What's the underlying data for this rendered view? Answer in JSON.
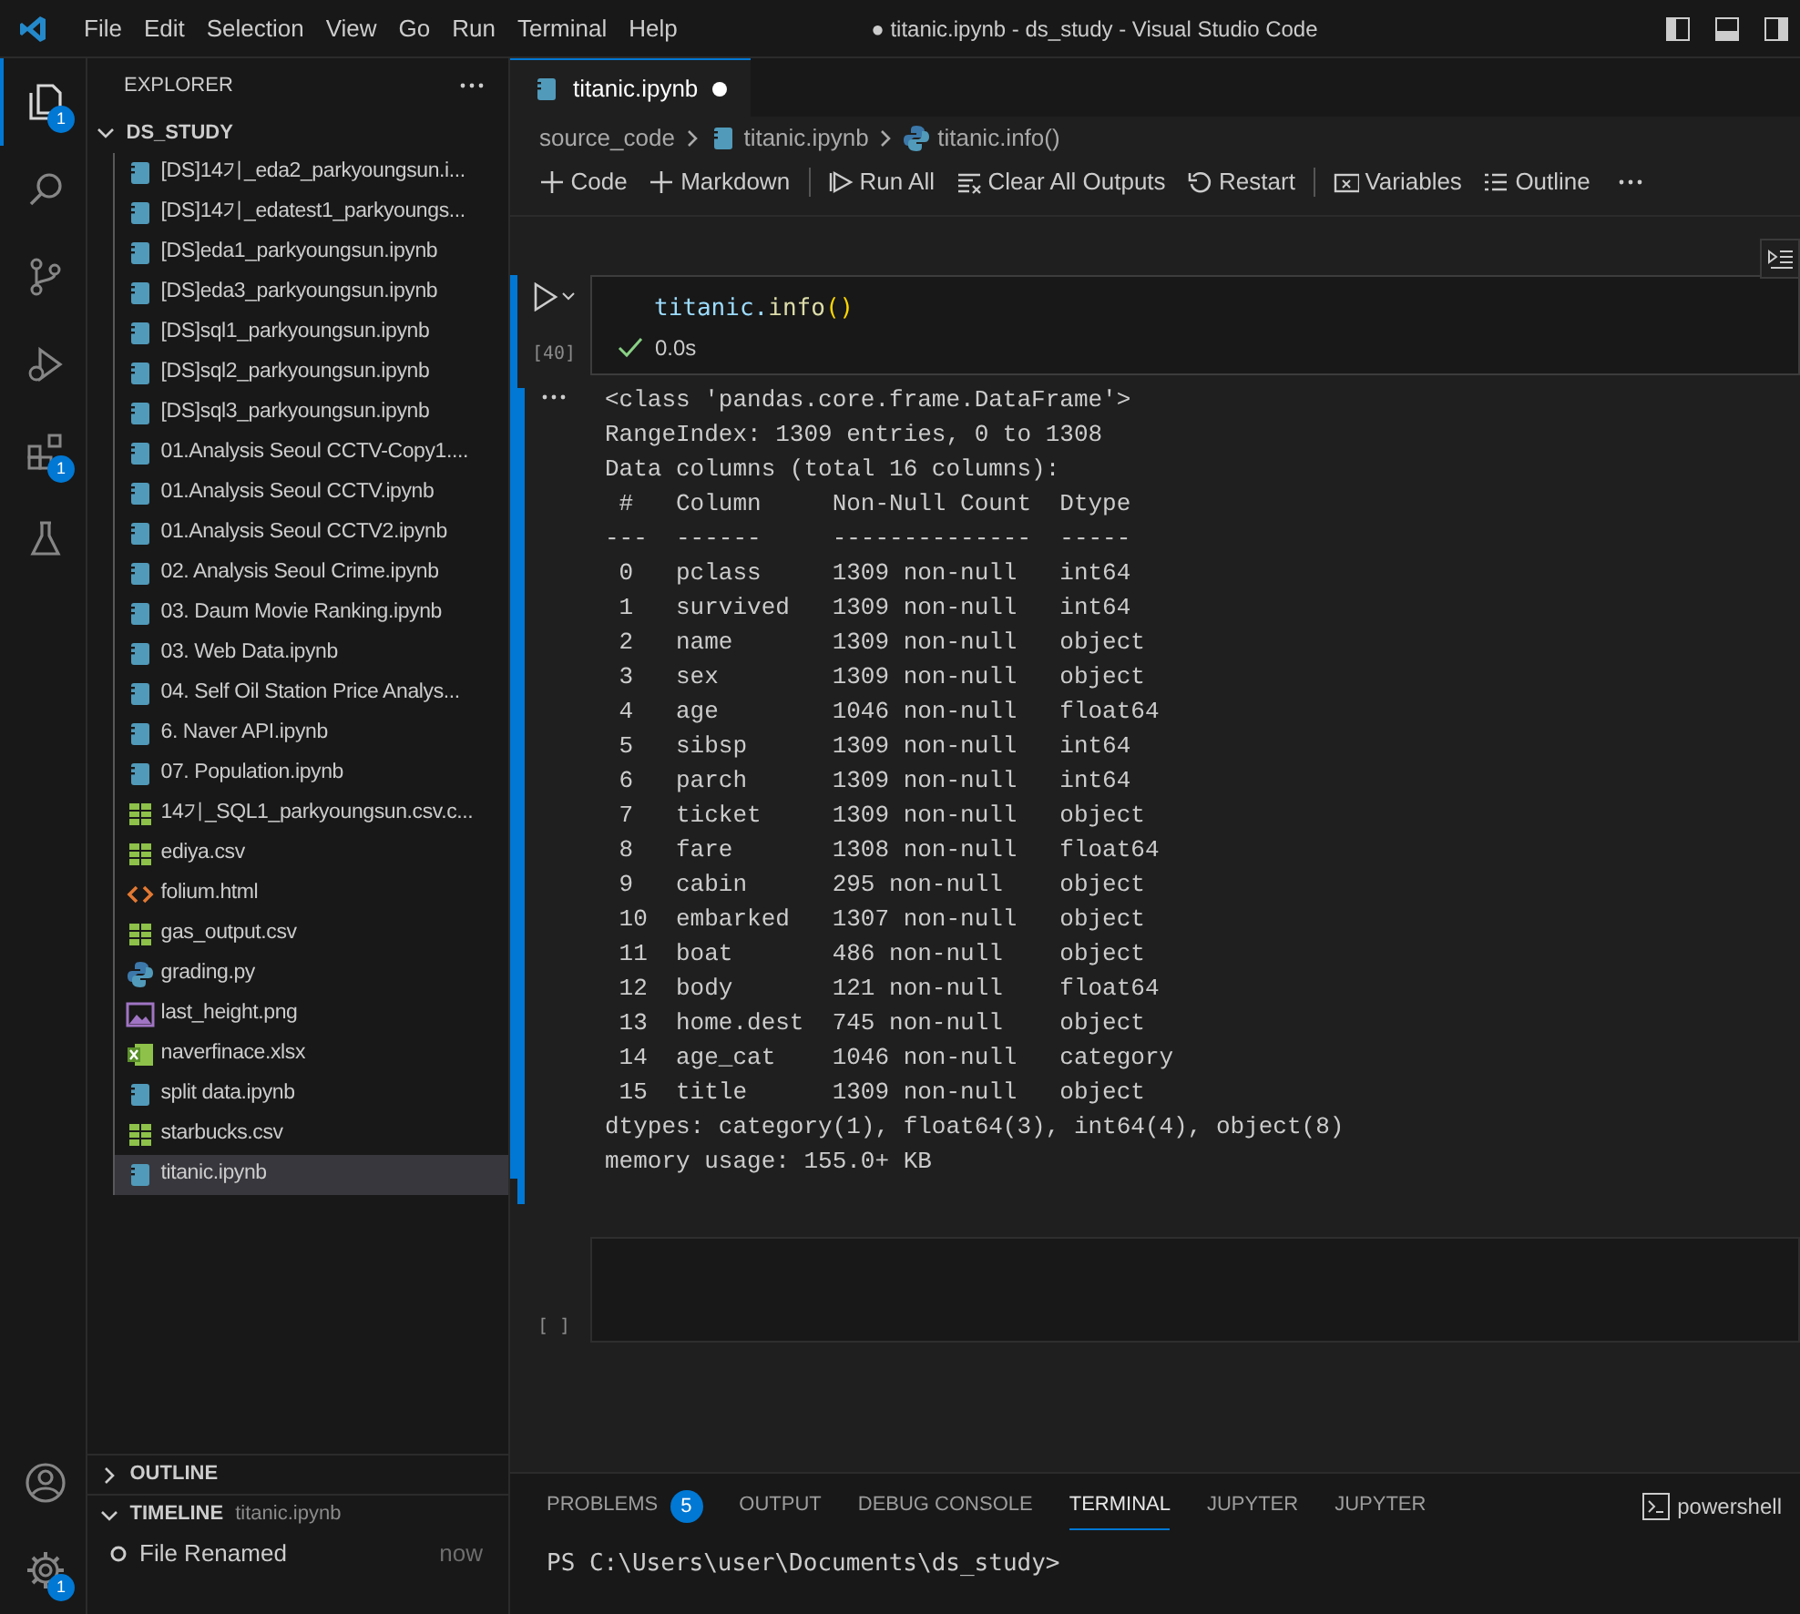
{
  "title_bar": {
    "menu": [
      "File",
      "Edit",
      "Selection",
      "View",
      "Go",
      "Run",
      "Terminal",
      "Help"
    ],
    "title": "● titanic.ipynb - ds_study - Visual Studio Code"
  },
  "activity_bar": [
    {
      "kind": "explorer",
      "selected": true,
      "badge": "1"
    },
    {
      "kind": "search",
      "selected": false
    },
    {
      "kind": "source-control",
      "selected": false
    },
    {
      "kind": "debug",
      "selected": false
    },
    {
      "kind": "extensions",
      "selected": false,
      "badge": "1"
    },
    {
      "kind": "testing",
      "selected": false
    }
  ],
  "activity_bottom": [
    {
      "kind": "account"
    },
    {
      "kind": "settings",
      "badge": "1"
    }
  ],
  "sidebar": {
    "title": "EXPLORER",
    "folder": "DS_STUDY",
    "files": [
      {
        "name": "[DS]14기_eda2_parkyoungsun.i...",
        "kind": "notebook",
        "selected": false
      },
      {
        "name": "[DS]14기_edatest1_parkyoungs...",
        "kind": "notebook",
        "selected": false
      },
      {
        "name": "[DS]eda1_parkyoungsun.ipynb",
        "kind": "notebook",
        "selected": false
      },
      {
        "name": "[DS]eda3_parkyoungsun.ipynb",
        "kind": "notebook",
        "selected": false
      },
      {
        "name": "[DS]sql1_parkyoungsun.ipynb",
        "kind": "notebook",
        "selected": false
      },
      {
        "name": "[DS]sql2_parkyoungsun.ipynb",
        "kind": "notebook",
        "selected": false
      },
      {
        "name": "[DS]sql3_parkyoungsun.ipynb",
        "kind": "notebook",
        "selected": false
      },
      {
        "name": "01.Analysis Seoul CCTV-Copy1....",
        "kind": "notebook",
        "selected": false
      },
      {
        "name": "01.Analysis Seoul CCTV.ipynb",
        "kind": "notebook",
        "selected": false
      },
      {
        "name": "01.Analysis Seoul CCTV2.ipynb",
        "kind": "notebook",
        "selected": false
      },
      {
        "name": "02. Analysis Seoul Crime.ipynb",
        "kind": "notebook",
        "selected": false
      },
      {
        "name": "03. Daum Movie Ranking.ipynb",
        "kind": "notebook",
        "selected": false
      },
      {
        "name": "03. Web Data.ipynb",
        "kind": "notebook",
        "selected": false
      },
      {
        "name": "04. Self Oil Station Price Analys...",
        "kind": "notebook",
        "selected": false
      },
      {
        "name": "6. Naver API.ipynb",
        "kind": "notebook",
        "selected": false
      },
      {
        "name": "07. Population.ipynb",
        "kind": "notebook",
        "selected": false
      },
      {
        "name": "14기_SQL1_parkyoungsun.csv.c...",
        "kind": "csv",
        "selected": false
      },
      {
        "name": "ediya.csv",
        "kind": "csv",
        "selected": false
      },
      {
        "name": "folium.html",
        "kind": "html",
        "selected": false
      },
      {
        "name": "gas_output.csv",
        "kind": "csv",
        "selected": false
      },
      {
        "name": "grading.py",
        "kind": "python",
        "selected": false
      },
      {
        "name": "last_height.png",
        "kind": "image",
        "selected": false
      },
      {
        "name": "naverfinace.xlsx",
        "kind": "excel",
        "selected": false
      },
      {
        "name": "split data.ipynb",
        "kind": "notebook",
        "selected": false
      },
      {
        "name": "starbucks.csv",
        "kind": "csv",
        "selected": false
      },
      {
        "name": "titanic.ipynb",
        "kind": "notebook",
        "selected": true
      }
    ],
    "outline": {
      "label": "OUTLINE",
      "expanded": false
    },
    "timeline": {
      "label": "TIMELINE",
      "subtitle": "titanic.ipynb",
      "expanded": true,
      "entries": [
        {
          "label": "File Renamed",
          "time": "now"
        }
      ]
    }
  },
  "editor": {
    "tabs": [
      {
        "label": "titanic.ipynb",
        "dirty": true,
        "selected": true
      }
    ],
    "breadcrumbs": [
      "source_code",
      "titanic.ipynb",
      "titanic.info()"
    ],
    "toolbar": [
      {
        "label": "Code",
        "kind": "plus"
      },
      {
        "label": "Markdown",
        "kind": "plus"
      },
      {
        "label": "Run All",
        "kind": "run"
      },
      {
        "label": "Clear All Outputs",
        "kind": "clear"
      },
      {
        "label": "Restart",
        "kind": "restart"
      },
      {
        "label": "Variables",
        "kind": "variables"
      },
      {
        "label": "Outline",
        "kind": "outline"
      }
    ],
    "cells": [
      {
        "execution": "[40]",
        "code": [
          {
            "text": "titanic.",
            "kind": "variable"
          },
          {
            "text": "info",
            "kind": "function"
          },
          {
            "text": "()",
            "kind": "bracket"
          }
        ],
        "status": "0.0s",
        "focused": true,
        "output": [
          "<class 'pandas.core.frame.DataFrame'>",
          "RangeIndex: 1309 entries, 0 to 1308",
          "Data columns (total 16 columns):",
          " #   Column     Non-Null Count  Dtype   ",
          "---  ------     --------------  -----   ",
          " 0   pclass     1309 non-null   int64   ",
          " 1   survived   1309 non-null   int64   ",
          " 2   name       1309 non-null   object  ",
          " 3   sex        1309 non-null   object  ",
          " 4   age        1046 non-null   float64 ",
          " 5   sibsp      1309 non-null   int64   ",
          " 6   parch      1309 non-null   int64   ",
          " 7   ticket     1309 non-null   object  ",
          " 8   fare       1308 non-null   float64 ",
          " 9   cabin      295 non-null    object  ",
          " 10  embarked   1307 non-null   object  ",
          " 11  boat       486 non-null    object  ",
          " 12  body       121 non-null    float64 ",
          " 13  home.dest  745 non-null    object  ",
          " 14  age_cat    1046 non-null   category",
          " 15  title      1309 non-null   object  ",
          "dtypes: category(1), float64(3), int64(4), object(8)",
          "memory usage: 155.0+ KB"
        ]
      },
      {
        "execution": "[ ]",
        "focused": false
      }
    ]
  },
  "panel": {
    "tabs": [
      {
        "label": "PROBLEMS",
        "selected": false,
        "badge": "5"
      },
      {
        "label": "OUTPUT",
        "selected": false
      },
      {
        "label": "DEBUG CONSOLE",
        "selected": false
      },
      {
        "label": "TERMINAL",
        "selected": true
      },
      {
        "label": "JUPYTER",
        "selected": false
      },
      {
        "label": "JUPYTER",
        "selected": false
      }
    ],
    "terminal_profile": "powershell",
    "terminal_lines": [
      "PS C:\\Users\\user\\Documents\\ds_study>"
    ]
  }
}
